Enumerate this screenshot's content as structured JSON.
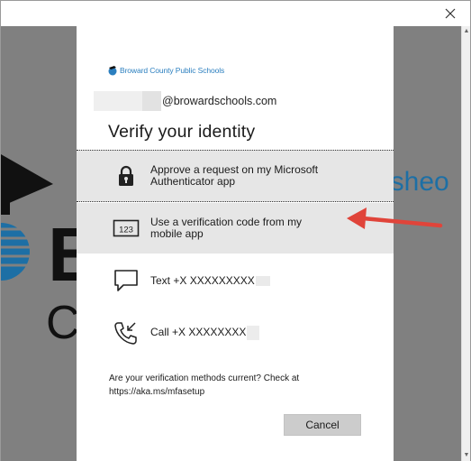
{
  "window": {
    "close_label": "×"
  },
  "background": {
    "text_top": "isheo",
    "text_letters": "B      AI",
    "text_bottom": "C                    Sch"
  },
  "dialog": {
    "brand_name": "Broward County Public Schools",
    "email_suffix": "@browardschools.com",
    "title": "Verify your identity",
    "options": [
      {
        "label": "Approve a request on my Microsoft Authenticator app",
        "icon": "lock-icon"
      },
      {
        "label": "Use a verification code from my mobile app",
        "icon": "code-123-icon",
        "icon_text": "123"
      },
      {
        "label": "Text +X XXXXXXXXX",
        "icon": "chat-bubble-icon"
      },
      {
        "label": "Call +X XXXXXXXX",
        "icon": "phone-icon"
      }
    ],
    "footer": "Are your verification methods current? Check at https://aka.ms/mfasetup",
    "cancel_label": "Cancel"
  },
  "colors": {
    "brand": "#2b7fbf",
    "annotation_arrow": "#e0443a",
    "backdrop": "#808080",
    "option_highlight": "#e6e6e6"
  }
}
